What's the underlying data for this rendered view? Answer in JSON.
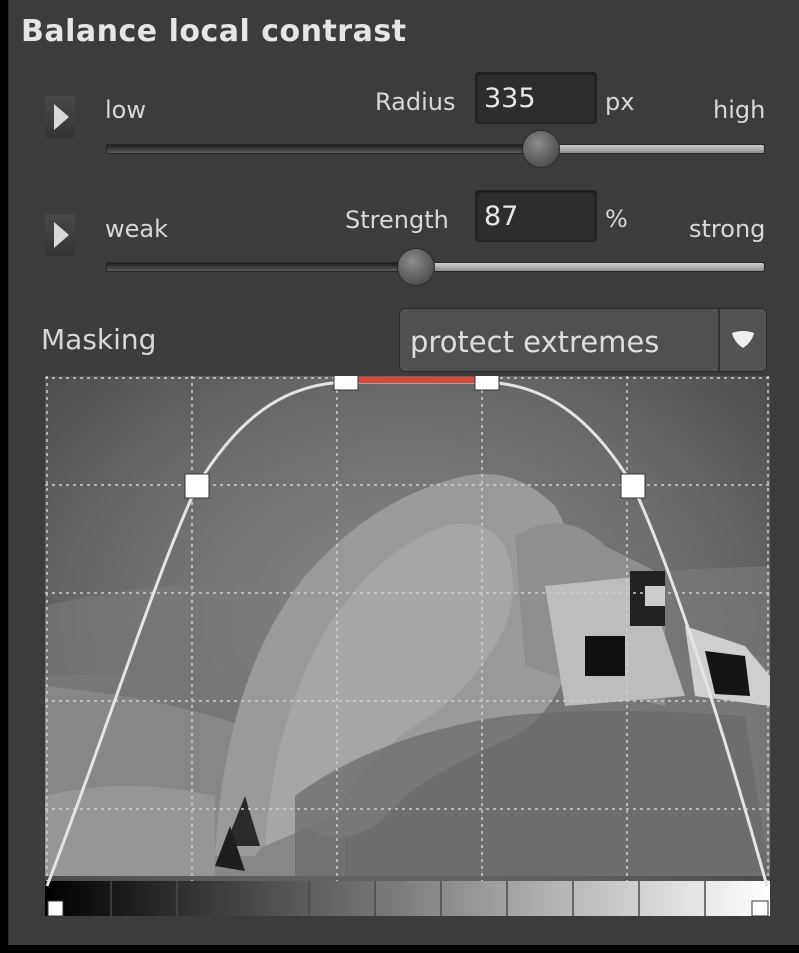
{
  "panel": {
    "title": "Balance local contrast"
  },
  "radius": {
    "label": "Radius",
    "value": "335",
    "unit": "px",
    "min_label": "low",
    "max_label": "high",
    "position": 0.66
  },
  "strength": {
    "label": "Strength",
    "value": "87",
    "unit": "%",
    "min_label": "weak",
    "max_label": "strong",
    "position": 0.47
  },
  "masking": {
    "label": "Masking",
    "selected": "protect extremes"
  },
  "colors": {
    "panel_bg": "#3c3c3c",
    "text": "#d8d8d8",
    "curve": "#e4e4e4",
    "curve_highlight": "#d84a3a",
    "control_point": "#ffffff"
  },
  "icons": {
    "radius_expand": "triangle-right-icon",
    "strength_expand": "triangle-right-icon",
    "dropdown": "chevron-down-icon"
  }
}
